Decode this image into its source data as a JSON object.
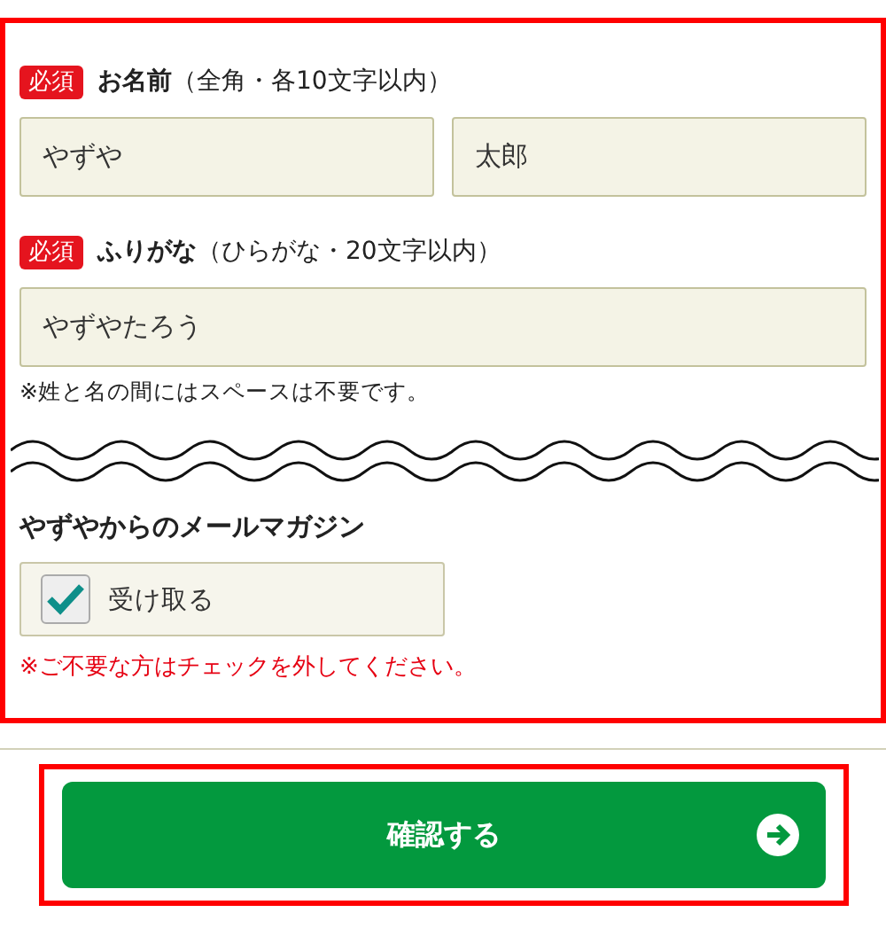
{
  "name_section": {
    "badge": "必須",
    "label": "**お名前**（全角・各10文字以内）",
    "fields": [
      {
        "value": "やずや"
      },
      {
        "value": "太郎"
      }
    ]
  },
  "kana_section": {
    "badge": "必須",
    "label": "**ふりがな**（ひらがな・20文字以内）",
    "field": {
      "value": "やずやたろう"
    },
    "note": "※姓と名の間にはスペースは不要です。"
  },
  "newsletter": {
    "title": "やずやからのメールマガジン",
    "checkbox": {
      "label": "受け取る",
      "checked": true
    },
    "warning": "※ご不要な方はチェックを外してください。"
  },
  "confirm_button": {
    "label": "確認する"
  }
}
